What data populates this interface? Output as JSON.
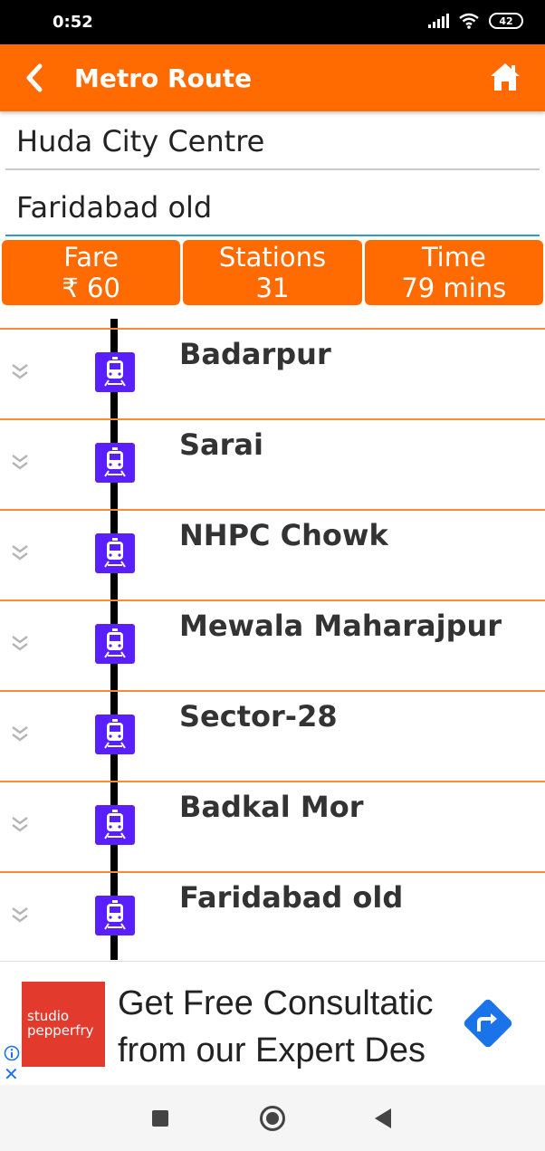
{
  "status_bar": {
    "time": "0:52",
    "battery": "42"
  },
  "app_bar": {
    "title": "Metro Route",
    "back_icon": "back-chevron-icon",
    "home_icon": "home-icon"
  },
  "route": {
    "from": "Huda City Centre",
    "to": "Faridabad old"
  },
  "summary": {
    "fare_label": "Fare",
    "fare_value": "₹ 60",
    "stations_label": "Stations",
    "stations_value": "31",
    "time_label": "Time",
    "time_value": "79 mins"
  },
  "stations": [
    {
      "name": "Badarpur"
    },
    {
      "name": "Sarai"
    },
    {
      "name": "NHPC Chowk"
    },
    {
      "name": "Mewala Maharajpur"
    },
    {
      "name": "Sector-28"
    },
    {
      "name": "Badkal Mor"
    },
    {
      "name": "Faridabad old"
    }
  ],
  "colors": {
    "accent": "#ff6b00",
    "train_icon": "#5a1fff",
    "line": "#000000"
  },
  "ad": {
    "logo_line1": "studio",
    "logo_line2": "pepperfry",
    "line1": "Get Free Consultatic",
    "line2": "from our Expert Des"
  }
}
